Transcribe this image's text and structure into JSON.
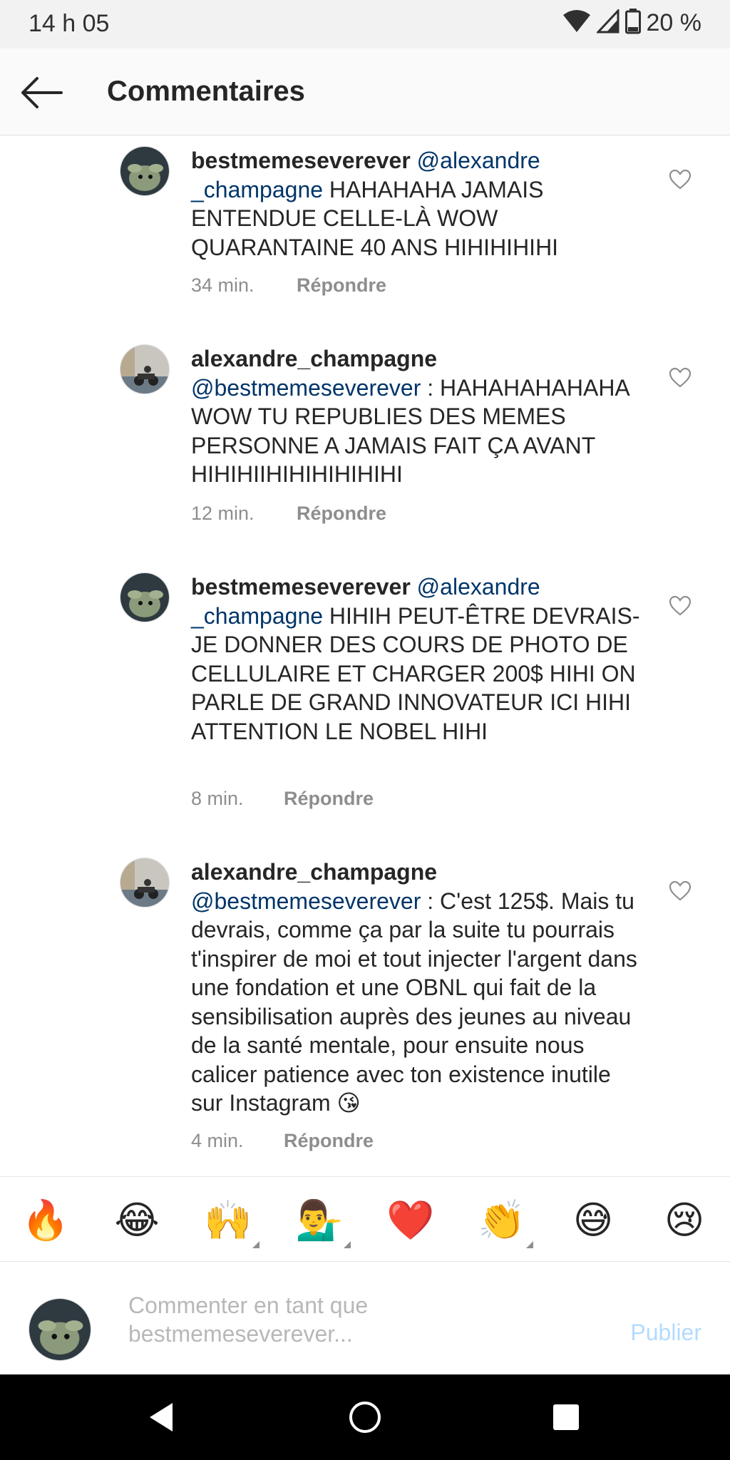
{
  "status_bar": {
    "time": "14 h 05",
    "battery": "20 %"
  },
  "header": {
    "title": "Commentaires"
  },
  "comments": [
    {
      "username": "bestmemeseverever",
      "mention": "@alexandre _champagne",
      "text": " HAHAHAHA JAMAIS ENTENDUE CELLE-LÀ WOW QUARANTAINE 40 ANS HIHIHIHIHI",
      "time": "34 min.",
      "reply": "Répondre"
    },
    {
      "username": "alexandre_champagne",
      "mention": "@bestmemeseverever",
      "text": " : HAHAHAHAHAHA WOW TU REPUBLIES DES MEMES PERSONNE A JAMAIS FAIT ÇA AVANT HIHIHIIHIHIHIHIHIHI",
      "time": "12 min.",
      "reply": "Répondre"
    },
    {
      "username": "bestmemeseverever",
      "mention": "@alexandre _champagne",
      "text": " HIHIH PEUT-ÊTRE DEVRAIS-JE DONNER DES COURS DE PHOTO DE CELLULAIRE ET CHARGER 200$ HIHI ON PARLE DE GRAND INNOVATEUR ICI HIHI ATTENTION LE NOBEL HIHI",
      "time": "8 min.",
      "reply": "Répondre"
    },
    {
      "username": "alexandre_champagne",
      "mention": "@bestmemeseverever",
      "text": " : C'est 125$. Mais tu devrais, comme ça par la suite tu pourrais t'inspirer de moi et tout injecter l'argent dans une fondation et une OBNL qui fait de la sensibilisation auprès des jeunes au niveau de la santé mentale, pour ensuite nous calicer patience avec ton existence inutile sur Instagram 😘",
      "time": "4 min.",
      "reply": "Répondre"
    }
  ],
  "emoji_bar": [
    "🔥",
    "😂",
    "🙌",
    "💁‍♂️",
    "❤️",
    "👏",
    "😅",
    "😢"
  ],
  "composer": {
    "placeholder": "Commenter en tant que bestmemeseverever...",
    "publish": "Publier"
  },
  "colors": {
    "mention": "#003569",
    "meta": "#8e8e8e",
    "publish_disabled": "#b3dbff",
    "status_bar_bg": "#f2f2f2"
  }
}
